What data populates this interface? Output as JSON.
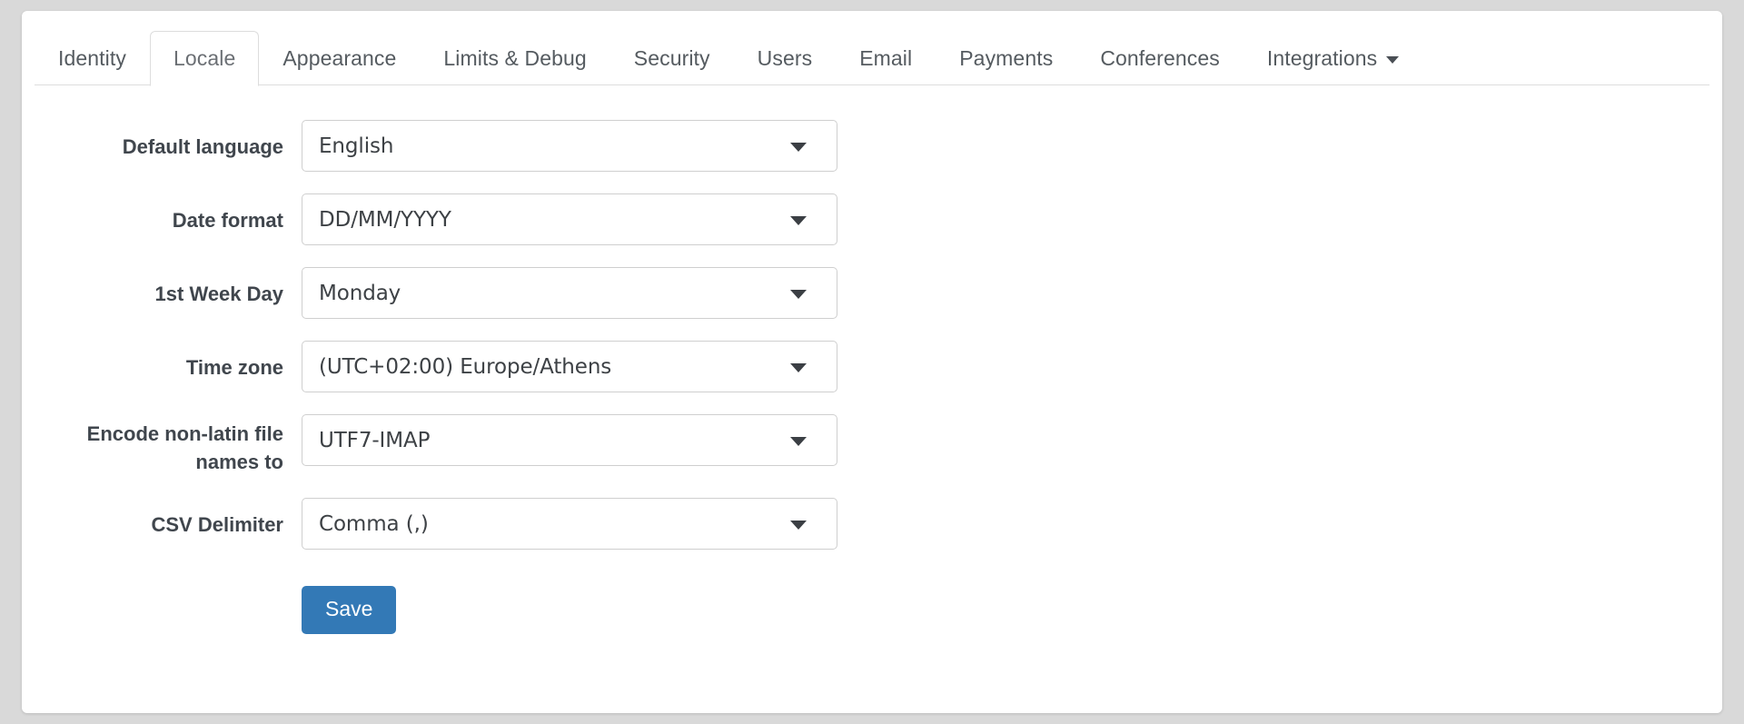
{
  "tabs": [
    {
      "label": "Identity",
      "active": false,
      "has_caret": false
    },
    {
      "label": "Locale",
      "active": true,
      "has_caret": false
    },
    {
      "label": "Appearance",
      "active": false,
      "has_caret": false
    },
    {
      "label": "Limits & Debug",
      "active": false,
      "has_caret": false
    },
    {
      "label": "Security",
      "active": false,
      "has_caret": false
    },
    {
      "label": "Users",
      "active": false,
      "has_caret": false
    },
    {
      "label": "Email",
      "active": false,
      "has_caret": false
    },
    {
      "label": "Payments",
      "active": false,
      "has_caret": false
    },
    {
      "label": "Conferences",
      "active": false,
      "has_caret": false
    },
    {
      "label": "Integrations",
      "active": false,
      "has_caret": true
    }
  ],
  "form": {
    "fields": [
      {
        "label": "Default language",
        "value": "English"
      },
      {
        "label": "Date format",
        "value": "DD/MM/YYYY"
      },
      {
        "label": "1st Week Day",
        "value": "Monday"
      },
      {
        "label": "Time zone",
        "value": "(UTC+02:00) Europe/Athens"
      },
      {
        "label": "Encode non-latin file names to",
        "value": "UTF7-IMAP"
      },
      {
        "label": "CSV Delimiter",
        "value": "Comma (,)"
      }
    ],
    "save_label": "Save"
  },
  "colors": {
    "accent": "#3379b6",
    "page_background": "#d9d9d9",
    "card_background": "#ffffff",
    "border": "#dddddd",
    "label_text": "#40464d",
    "tab_text": "#555b60"
  }
}
